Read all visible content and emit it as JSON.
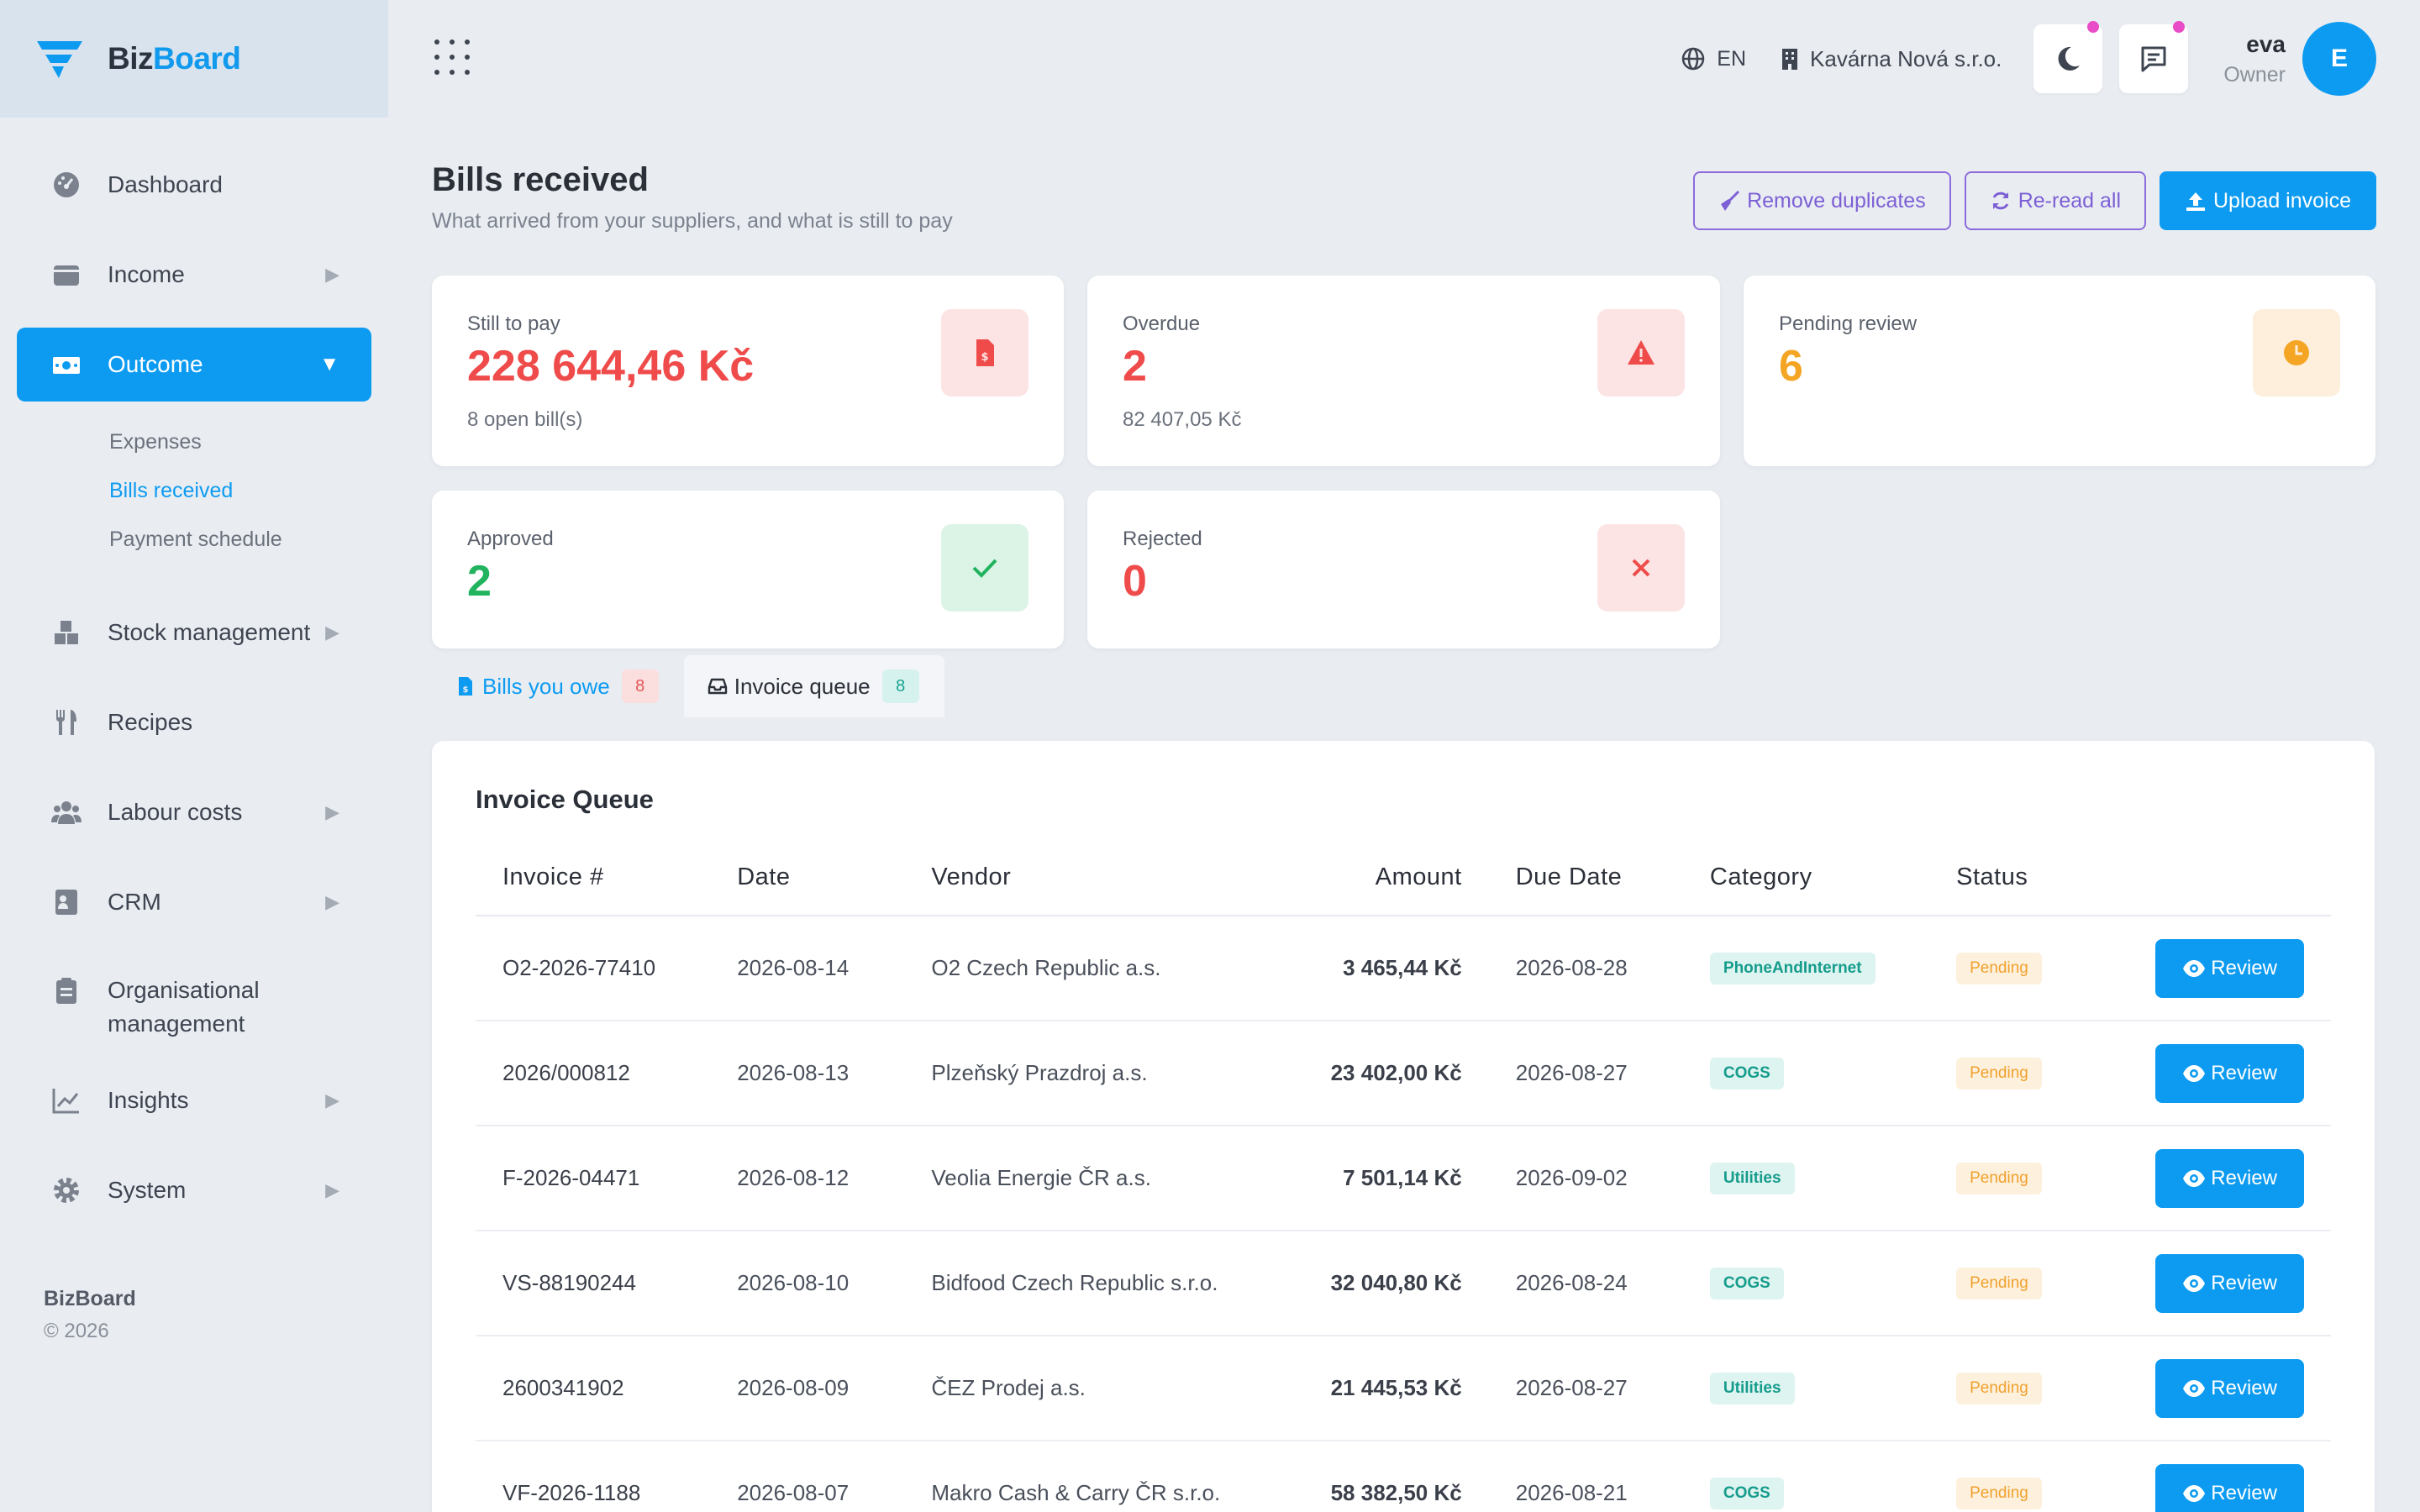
{
  "app": {
    "brand_part1": "Biz",
    "brand_part2": "Board",
    "accent": "#0d9bf1"
  },
  "sidebar": {
    "items": [
      {
        "label": "Dashboard",
        "icon": "dashboard-gauge-icon"
      },
      {
        "label": "Income",
        "icon": "wallet-icon"
      },
      {
        "label": "Outcome",
        "icon": "money-bill-icon",
        "active": true
      },
      {
        "label": "Stock management",
        "icon": "boxes-icon"
      },
      {
        "label": "Recipes",
        "icon": "utensils-icon"
      },
      {
        "label": "Labour costs",
        "icon": "users-icon"
      },
      {
        "label": "CRM",
        "icon": "contact-card-icon"
      },
      {
        "label": "Organisational management",
        "icon": "clipboard-icon"
      },
      {
        "label": "Insights",
        "icon": "chart-line-icon"
      },
      {
        "label": "System",
        "icon": "gear-icon"
      }
    ],
    "outcome_sub": [
      "Expenses",
      "Bills received",
      "Payment schedule"
    ],
    "footer_brand": "BizBoard",
    "footer_copy": "© 2026"
  },
  "topbar": {
    "lang": "EN",
    "company": "Kavárna Nová s.r.o.",
    "user_name": "eva",
    "user_role": "Owner",
    "avatar_initial": "E"
  },
  "page": {
    "title": "Bills received",
    "subtitle": "What arrived from your suppliers, and what is still to pay",
    "actions": {
      "remove_duplicates": "Remove duplicates",
      "reread_all": "Re-read all",
      "upload_invoice": "Upload invoice"
    }
  },
  "stats": {
    "still_to_pay": {
      "label": "Still to pay",
      "value": "228 644,46 Kč",
      "sub": "8 open bill(s)",
      "color": "#ef4b4b"
    },
    "overdue": {
      "label": "Overdue",
      "value": "2",
      "sub": "82 407,05 Kč",
      "color": "#ef4b4b"
    },
    "pending_review": {
      "label": "Pending review",
      "value": "6",
      "color": "#f5a524"
    },
    "approved": {
      "label": "Approved",
      "value": "2",
      "color": "#22b35e"
    },
    "rejected": {
      "label": "Rejected",
      "value": "0",
      "color": "#ef4b4b"
    }
  },
  "tabs": [
    {
      "label": "Bills you owe",
      "count": "8"
    },
    {
      "label": "Invoice queue",
      "count": "8"
    }
  ],
  "queue": {
    "title": "Invoice Queue",
    "columns": [
      "Invoice #",
      "Date",
      "Vendor",
      "Amount",
      "Due Date",
      "Category",
      "Status"
    ],
    "review_label": "Review",
    "rows": [
      {
        "invoice": "O2-2026-77410",
        "date": "2026-08-14",
        "vendor": "O2 Czech Republic a.s.",
        "amount": "3 465,44 Kč",
        "due": "2026-08-28",
        "category": "PhoneAndInternet",
        "status": "Pending"
      },
      {
        "invoice": "2026/000812",
        "date": "2026-08-13",
        "vendor": "Plzeňský Prazdroj a.s.",
        "amount": "23 402,00 Kč",
        "due": "2026-08-27",
        "category": "COGS",
        "status": "Pending"
      },
      {
        "invoice": "F-2026-04471",
        "date": "2026-08-12",
        "vendor": "Veolia Energie ČR a.s.",
        "amount": "7 501,14 Kč",
        "due": "2026-09-02",
        "category": "Utilities",
        "status": "Pending"
      },
      {
        "invoice": "VS-88190244",
        "date": "2026-08-10",
        "vendor": "Bidfood Czech Republic s.r.o.",
        "amount": "32 040,80 Kč",
        "due": "2026-08-24",
        "category": "COGS",
        "status": "Pending"
      },
      {
        "invoice": "2600341902",
        "date": "2026-08-09",
        "vendor": "ČEZ Prodej a.s.",
        "amount": "21 445,53 Kč",
        "due": "2026-08-27",
        "category": "Utilities",
        "status": "Pending"
      },
      {
        "invoice": "VF-2026-1188",
        "date": "2026-08-07",
        "vendor": "Makro Cash & Carry ČR s.r.o.",
        "amount": "58 382,50 Kč",
        "due": "2026-08-21",
        "category": "COGS",
        "status": "Pending"
      }
    ]
  }
}
